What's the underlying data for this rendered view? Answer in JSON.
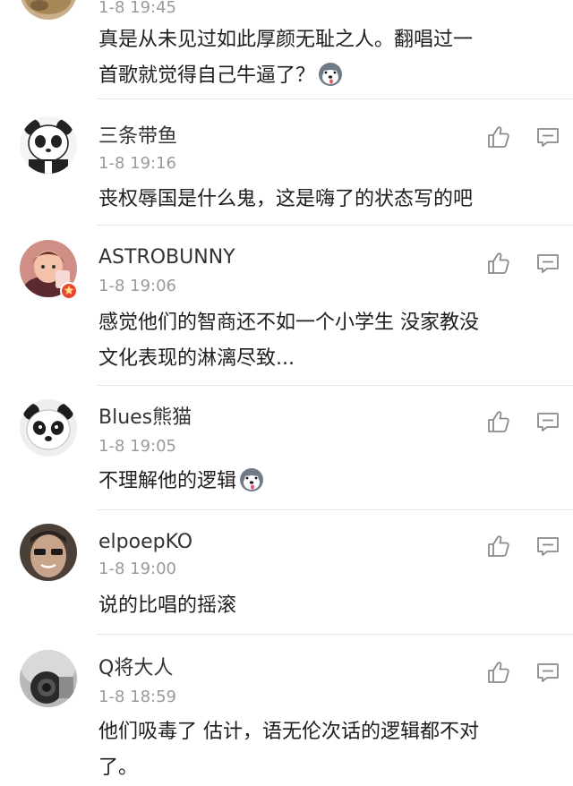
{
  "colors": {
    "username": "#333333",
    "timestamp": "#9a9a9a",
    "text": "#1e1e1e",
    "icon": "#8a8a8a",
    "badge": "#e8472c",
    "divider": "#e4e4e4"
  },
  "comments": [
    {
      "username": "",
      "timestamp": "1-8 19:45",
      "lines": [
        "真是从未见过如此厚颜无耻之人。翻唱过一",
        "首歌就觉得自己牛逼了？"
      ],
      "emoji": "dog-emoji"
    },
    {
      "username": "三条带鱼",
      "timestamp": "1-8 19:16",
      "lines": [
        "丧权辱国是什么鬼，这是嗨了的状态写的吧"
      ]
    },
    {
      "username": "ASTROBUNNY",
      "timestamp": "1-8 19:06",
      "lines": [
        "感觉他们的智商还不如一个小学生 没家教没",
        "文化表现的淋漓尽致..."
      ],
      "badge": "verified-badge"
    },
    {
      "username": "Blues熊猫",
      "timestamp": "1-8 19:05",
      "lines": [
        "不理解他的逻辑"
      ],
      "emoji": "dog-emoji"
    },
    {
      "username": "elpoepKO",
      "timestamp": "1-8 19:00",
      "lines": [
        "说的比唱的摇滚"
      ]
    },
    {
      "username": "Q将大人",
      "timestamp": "1-8 18:59",
      "lines": [
        "他们吸毒了 估计，语无伦次话的逻辑都不对",
        "了。"
      ]
    }
  ],
  "icons": {
    "like": "thumbs-up-icon",
    "reply": "comment-icon"
  }
}
